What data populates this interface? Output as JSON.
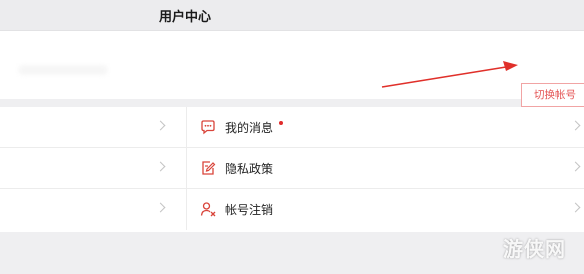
{
  "header": {
    "title": "用户中心"
  },
  "account": {
    "switch_label": "切换帐号"
  },
  "menu": {
    "items": [
      {
        "label": "我的消息",
        "icon": "message-bubble-icon",
        "has_notification": true
      },
      {
        "label": "隐私政策",
        "icon": "document-edit-icon"
      },
      {
        "label": "帐号注销",
        "icon": "user-remove-icon"
      }
    ]
  },
  "colors": {
    "accent": "#e45454",
    "notification_dot": "#e02b2b",
    "icon": "#d9443a"
  },
  "watermark": {
    "text": "游侠网"
  }
}
